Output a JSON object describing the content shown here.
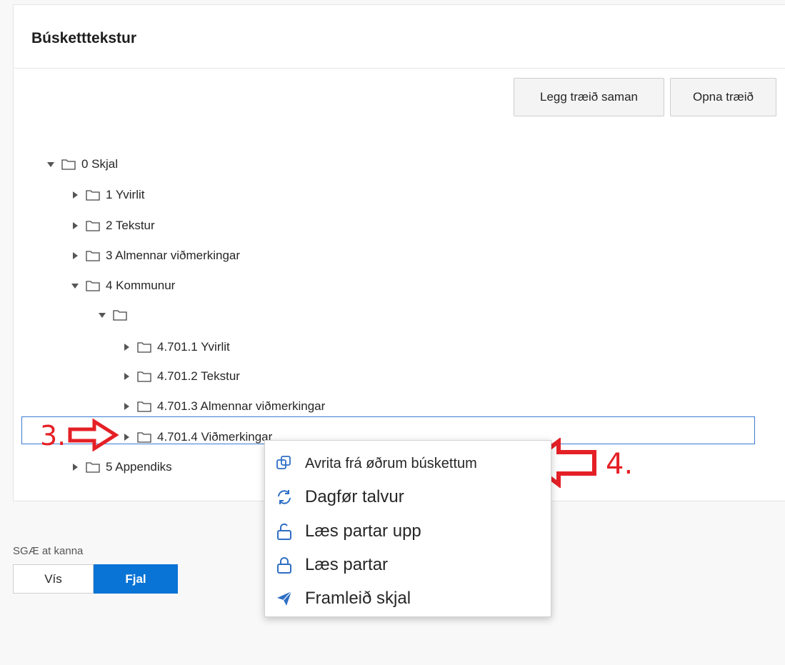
{
  "card": {
    "title": "Búsketttekstur",
    "collapse_label": "Legg træið saman",
    "expand_label": "Opna træið"
  },
  "tree": [
    {
      "label": "0 Skjal",
      "state": "expanded"
    },
    {
      "label": "1 Yvirlit",
      "state": "collapsed"
    },
    {
      "label": "2 Tekstur",
      "state": "collapsed"
    },
    {
      "label": "3 Almennar viðmerkingar",
      "state": "collapsed"
    },
    {
      "label": "4 Kommunur",
      "state": "expanded"
    },
    {
      "label": "",
      "state": "expanded"
    },
    {
      "label": "4.701.1 Yvirlit",
      "state": "collapsed"
    },
    {
      "label": "4.701.2 Tekstur",
      "state": "collapsed"
    },
    {
      "label": "4.701.3 Almennar viðmerkingar",
      "state": "collapsed"
    },
    {
      "label": "4.701.4 Viðmerkingar",
      "state": "collapsed",
      "selected": true
    },
    {
      "label": "5 Appendiks",
      "state": "collapsed"
    }
  ],
  "annotations": {
    "step3": "3.",
    "step4": "4.",
    "color": "#e42026"
  },
  "context_menu": [
    {
      "label": "Avrita frá øðrum búskettum",
      "icon": "copy-icon"
    },
    {
      "label": "Dagfør talvur",
      "icon": "refresh-icon"
    },
    {
      "label": "Læs partar upp",
      "icon": "unlock-icon"
    },
    {
      "label": "Læs partar",
      "icon": "lock-icon"
    },
    {
      "label": "Framleið skjal",
      "icon": "send-icon"
    }
  ],
  "bottom": {
    "label": "SGÆ at kanna",
    "options": [
      "Vís",
      "Fjal"
    ],
    "selected": "Fjal"
  },
  "colors": {
    "accent": "#0a73d6",
    "selection_border": "#3a7bd5",
    "icon_blue": "#2e6fc4"
  }
}
